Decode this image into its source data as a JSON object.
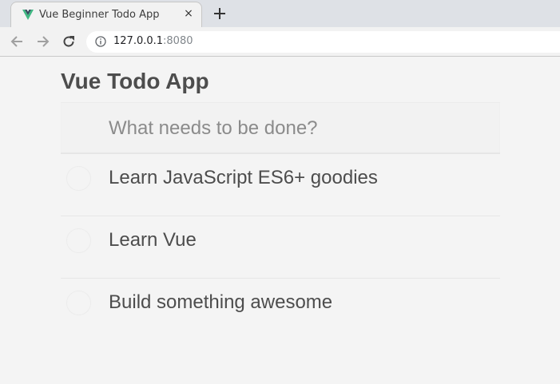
{
  "browser": {
    "tab": {
      "title": "Vue Beginner Todo App",
      "close_glyph": "×",
      "favicon": "vue-logo-icon"
    },
    "new_tab_icon": "plus-icon",
    "nav": {
      "back_icon": "arrow-left-icon",
      "forward_icon": "arrow-right-icon",
      "reload_icon": "reload-icon"
    },
    "address": {
      "info_icon": "info-icon",
      "host": "127.0.0.1",
      "port": ":8080"
    }
  },
  "app": {
    "title": "Vue Todo App",
    "new_todo_placeholder": "What needs to be done?",
    "todos": [
      {
        "label": "Learn JavaScript ES6+ goodies",
        "completed": false
      },
      {
        "label": "Learn Vue",
        "completed": false
      },
      {
        "label": "Build something awesome",
        "completed": false
      }
    ]
  },
  "colors": {
    "vue_green": "#41b883",
    "vue_dark": "#35495e",
    "text": "#4d4d4d",
    "background": "#f4f4f4"
  }
}
